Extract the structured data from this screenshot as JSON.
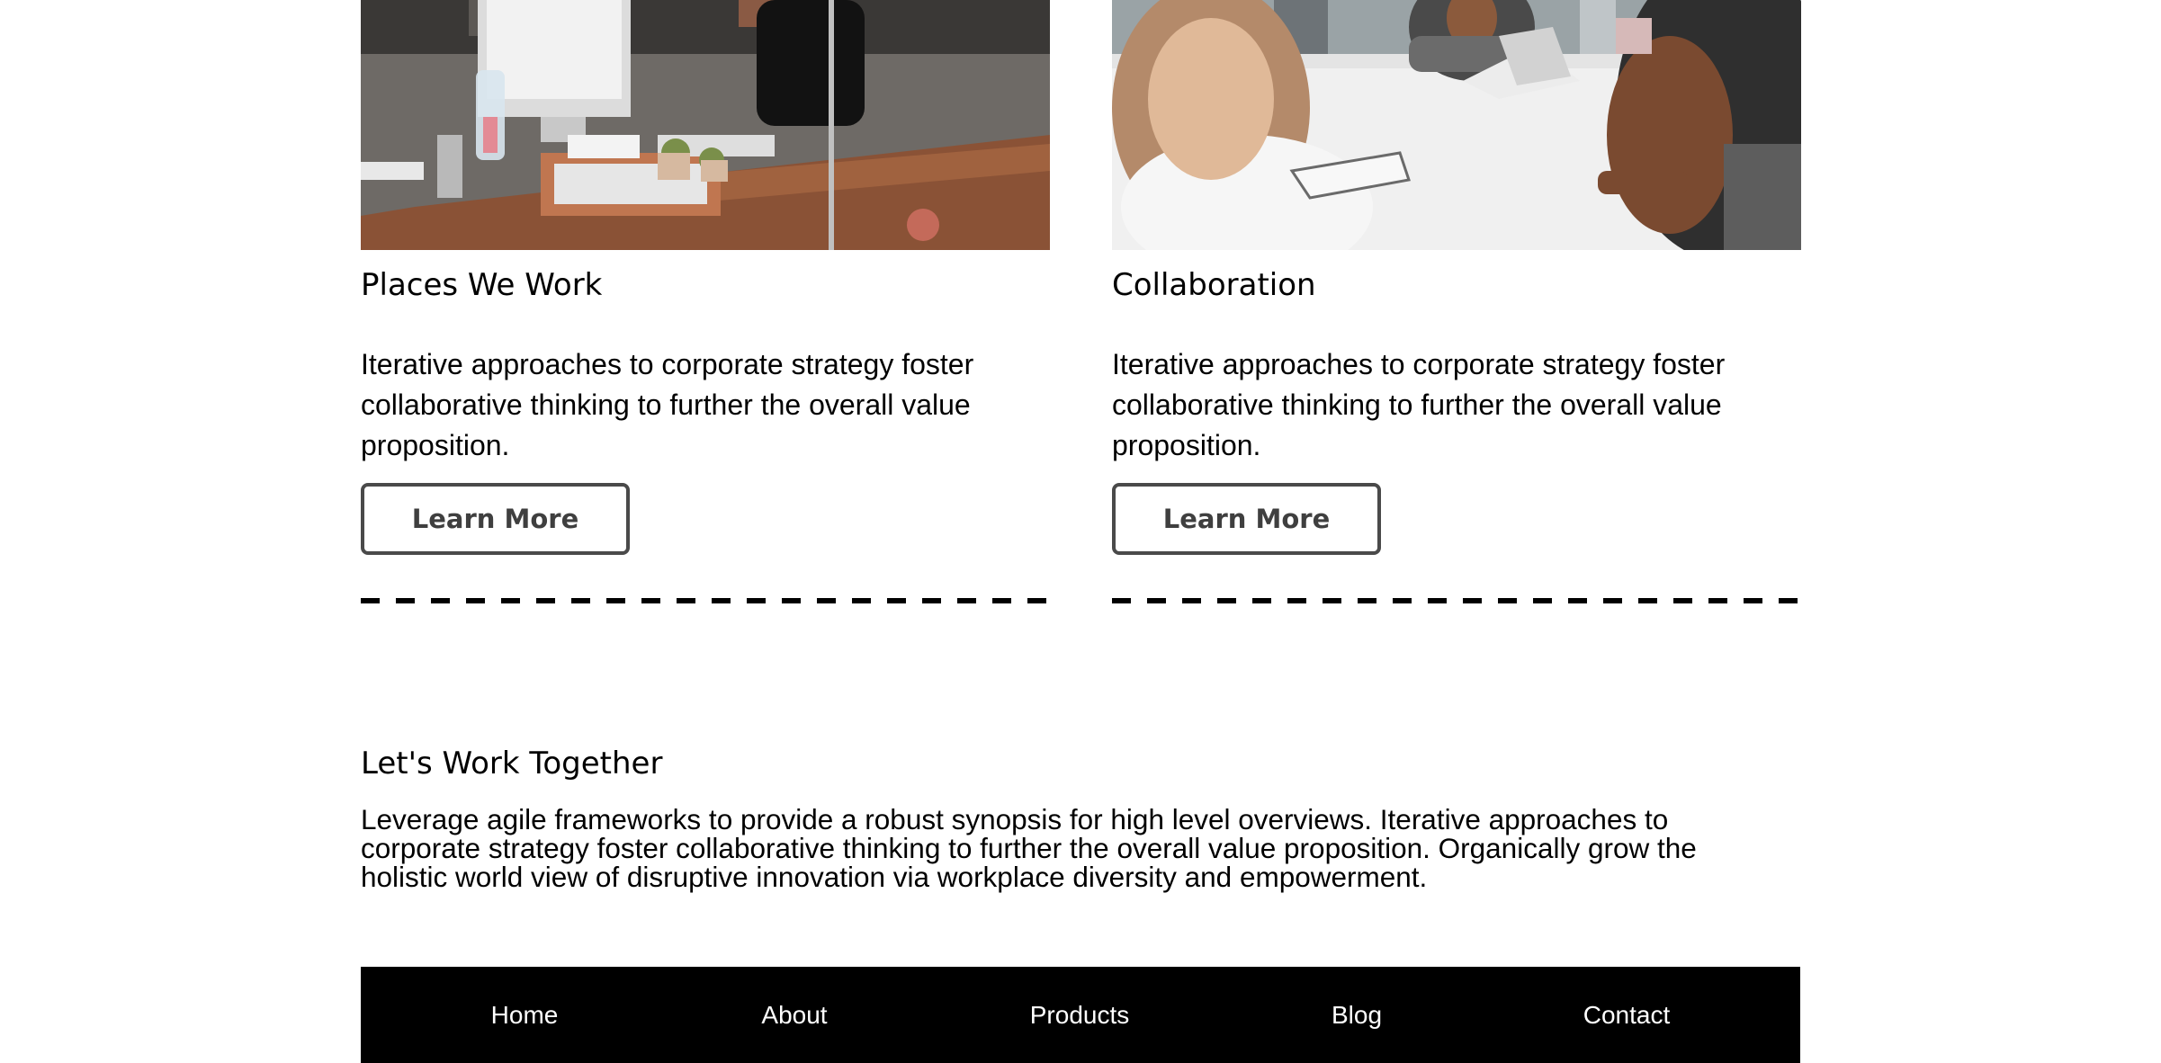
{
  "cards": [
    {
      "title": "Places We Work",
      "body": "Iterative approaches to corporate strategy foster collaborative thinking to further the overall value proposition.",
      "button_label": "Learn More"
    },
    {
      "title": "Collaboration",
      "body": "Iterative approaches to corporate strategy foster collaborative thinking to further the overall value proposition.",
      "button_label": "Learn More"
    }
  ],
  "together": {
    "heading": "Let's Work Together",
    "body": "Leverage agile frameworks to provide a robust synopsis for high level overviews. Iterative approaches to corporate strategy foster collaborative thinking to further the overall value proposition. Organically grow the holistic world view of disruptive innovation via workplace diversity and empowerment."
  },
  "footer": {
    "links": [
      "Home",
      "About",
      "Products",
      "Blog",
      "Contact"
    ]
  },
  "colors": {
    "footer_bg": "#000000",
    "button_border": "#4a4a4a"
  }
}
